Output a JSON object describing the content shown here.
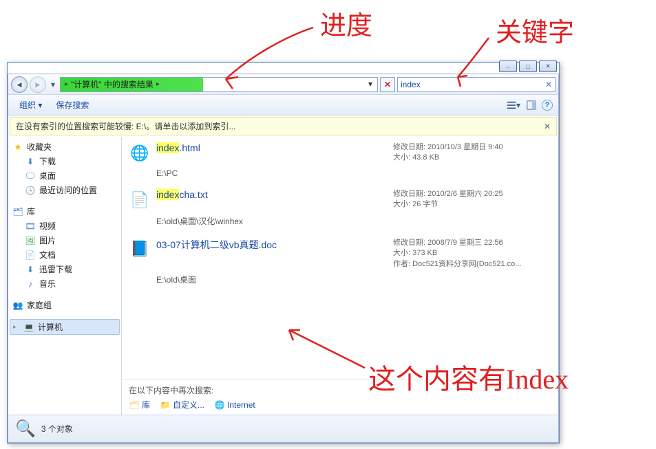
{
  "window_controls": {
    "min": "–",
    "max": "□",
    "close": "✕"
  },
  "nav": {
    "breadcrumb_label": "\"计算机\" 中的搜索结果",
    "arrow": "▸",
    "search_value": "index"
  },
  "toolbar": {
    "organize": "组织",
    "save_search": "保存搜索"
  },
  "infobar": "在没有索引的位置搜索可能较慢: E:\\。请单击以添加到索引...",
  "sidebar": {
    "favorites": {
      "label": "收藏夹",
      "items": [
        "下载",
        "桌面",
        "最近访问的位置"
      ]
    },
    "libraries": {
      "label": "库",
      "items": [
        "视频",
        "图片",
        "文档",
        "迅雷下载",
        "音乐"
      ]
    },
    "homegroup": "家庭组",
    "computer": "计算机"
  },
  "results": [
    {
      "name_pre": "index",
      "name_rest": ".html",
      "icon": "html",
      "meta": [
        "修改日期: 2010/10/3 星期日 9:40",
        "大小: 43.8 KB"
      ],
      "path": "E:\\PC"
    },
    {
      "name_pre": "index",
      "name_rest": "cha.txt",
      "icon": "txt",
      "meta": [
        "修改日期: 2010/2/6 星期六 20:25",
        "大小: 26 字节"
      ],
      "path": "E:\\old\\桌面\\汉化\\winhex"
    },
    {
      "name_pre": "",
      "name_rest": "03-07计算机二级vb真题.doc",
      "icon": "doc",
      "meta": [
        "修改日期: 2008/7/9 星期三 22:56",
        "大小: 373 KB",
        "作者: Doc521资料分享网(Doc521.co..."
      ],
      "path": "E:\\old\\桌面"
    }
  ],
  "search_again": {
    "label": "在以下内容中再次搜索:",
    "lib": "库",
    "custom": "自定义...",
    "internet": "Internet"
  },
  "status": {
    "count": "3 个对象"
  },
  "annotations": {
    "a1": "进度",
    "a2": "关键字",
    "a3": "这个内容有Index"
  }
}
